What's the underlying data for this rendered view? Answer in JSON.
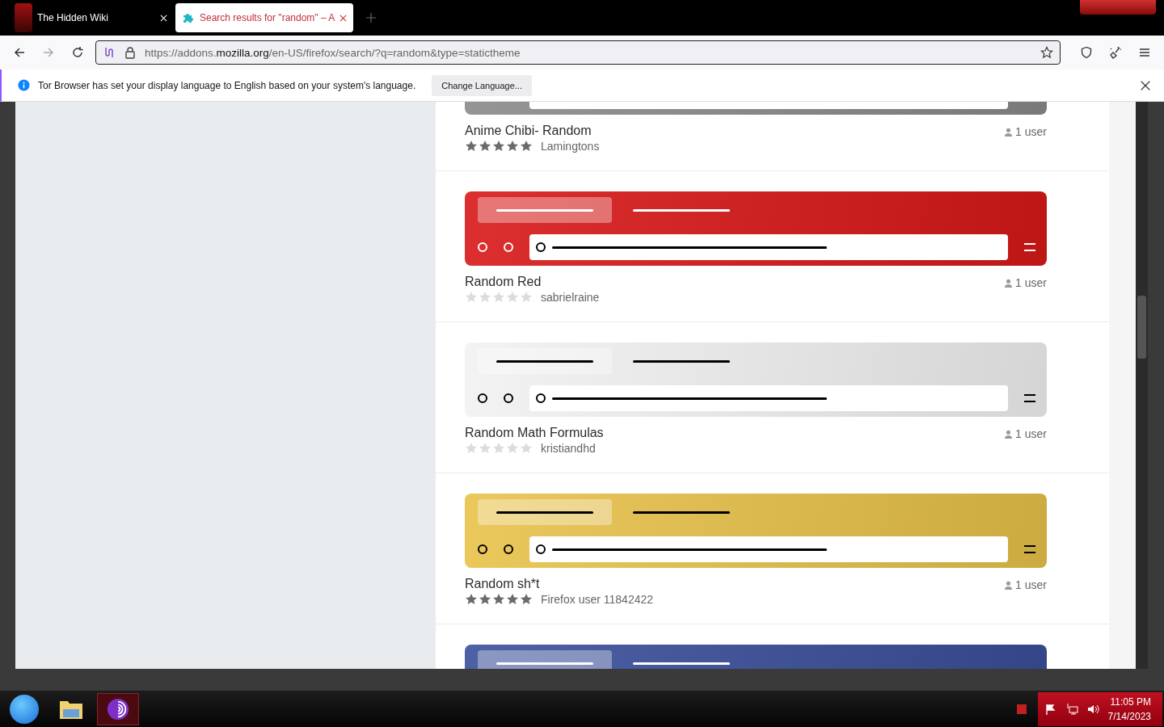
{
  "tabs": [
    {
      "title": "The Hidden Wiki",
      "kind": "wiki",
      "selected": false
    },
    {
      "title": "Search results for \"random\" – A",
      "kind": "addons",
      "selected": true
    }
  ],
  "toolbar": {
    "forward_enabled": false,
    "url_prefix": "https://addons.",
    "url_host": "mozilla.org",
    "url_path": "/en-US/firefox/search/?q=random&type=statictheme"
  },
  "notification": {
    "message": "Tor Browser has set your display language to English based on your system's language.",
    "button": "Change Language..."
  },
  "results": [
    {
      "title": "Anime Chibi- Random",
      "author": "Lamingtons",
      "users": "1 user",
      "stars": 5,
      "color": "#8a8a8a"
    },
    {
      "title": "Random Red",
      "author": "sabrielraine",
      "users": "1 user",
      "stars": 0,
      "color": "#d81818"
    },
    {
      "title": "Random Math Formulas",
      "author": "kristiandhd",
      "users": "1 user",
      "stars": 0,
      "color": "#f2f2f2"
    },
    {
      "title": "Random sh*t",
      "author": "Firefox user 11842422",
      "users": "1 user",
      "stars": 5,
      "color": "#e8c24a"
    },
    {
      "color": "#3a4f9a"
    }
  ],
  "taskbar": [
    {
      "kind": "start",
      "selected": false
    },
    {
      "kind": "folder",
      "selected": false
    },
    {
      "kind": "tor",
      "selected": true
    }
  ],
  "clock": {
    "time": "11:05 PM",
    "date": "7/14/2023"
  }
}
